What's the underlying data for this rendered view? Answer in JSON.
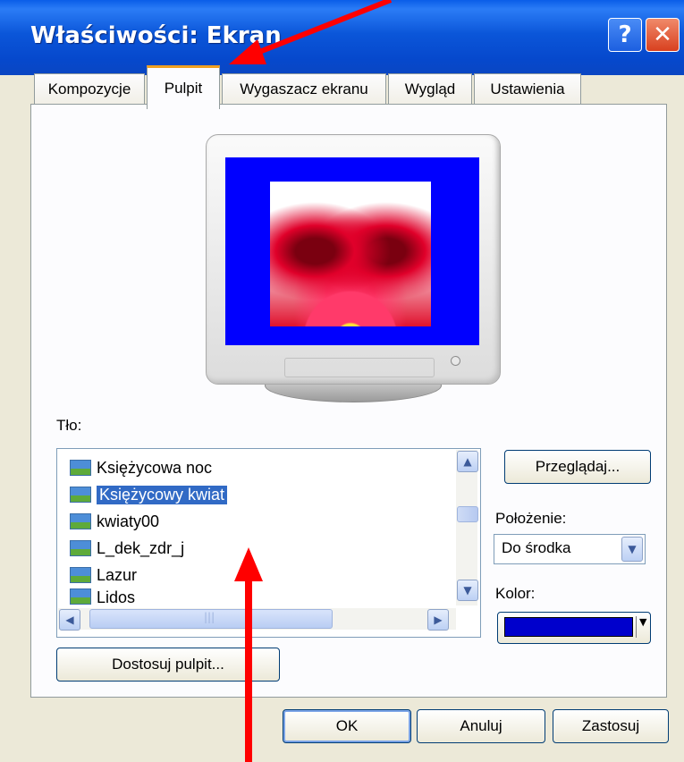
{
  "window": {
    "title": "Właściwości: Ekran",
    "help_glyph": "?",
    "close_glyph": "✕"
  },
  "tabs": [
    {
      "label": "Kompozycje",
      "active": false
    },
    {
      "label": "Pulpit",
      "active": true
    },
    {
      "label": "Wygaszacz ekranu",
      "active": false
    },
    {
      "label": "Wygląd",
      "active": false
    },
    {
      "label": "Ustawienia",
      "active": false
    }
  ],
  "background": {
    "label": "Tło:",
    "items": [
      {
        "label": "Księżycowa noc",
        "icon": "image-file-icon",
        "selected": false
      },
      {
        "label": "Księżycowy kwiat",
        "icon": "image-file-icon",
        "selected": true
      },
      {
        "label": "kwiaty00",
        "icon": "image-file-icon",
        "selected": false
      },
      {
        "label": "L_dek_zdr_j",
        "icon": "image-file-icon",
        "selected": false
      },
      {
        "label": "Lazur",
        "icon": "image-file-icon",
        "selected": false
      },
      {
        "label": "Lidos",
        "icon": "image-file-icon",
        "selected": false
      }
    ],
    "browse_label": "Przeglądaj..."
  },
  "position": {
    "label": "Położenie:",
    "value": "Do środka"
  },
  "color": {
    "label": "Kolor:",
    "value": "#0000cc"
  },
  "customize_label": "Dostosuj pulpit...",
  "footer": {
    "ok_label": "OK",
    "cancel_label": "Anuluj",
    "apply_label": "Zastosuj"
  },
  "colors": {
    "titlebar": "#0b56d9",
    "selection": "#316ac5",
    "screen_background": "#0000ff",
    "annotation": "#ff0000"
  }
}
